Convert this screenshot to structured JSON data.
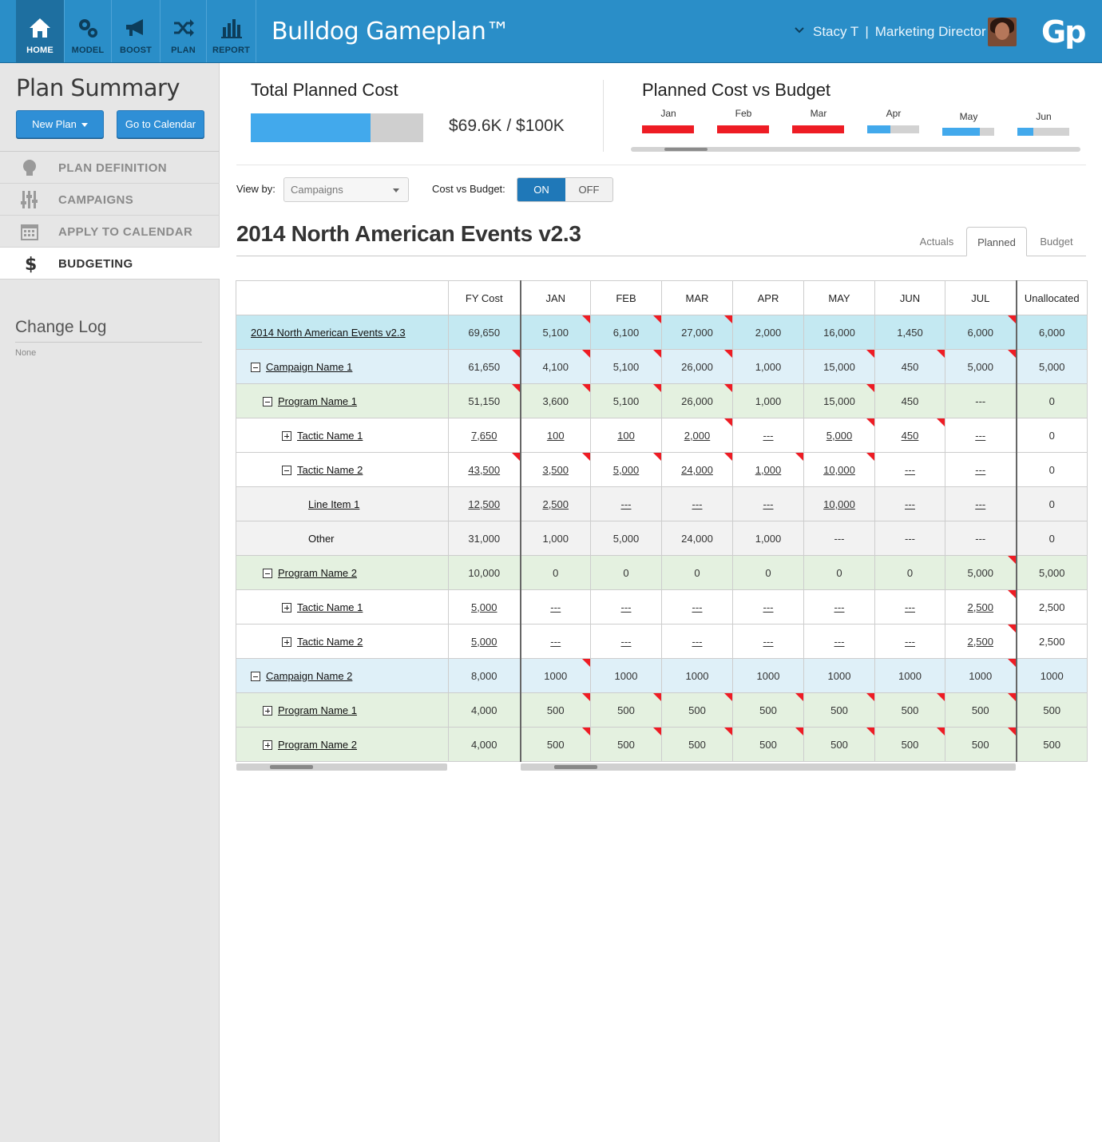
{
  "app": {
    "title": "Bulldog Gameplan™",
    "logo": "Gp",
    "user": "Stacy T",
    "role": "Marketing Director"
  },
  "nav": [
    {
      "label": "HOME",
      "icon": "home-icon",
      "active": true
    },
    {
      "label": "MODEL",
      "icon": "gears-icon",
      "active": false
    },
    {
      "label": "BOOST",
      "icon": "megaphone-icon",
      "active": false
    },
    {
      "label": "PLAN",
      "icon": "shuffle-icon",
      "active": false
    },
    {
      "label": "REPORT",
      "icon": "bar-chart-icon",
      "active": false
    }
  ],
  "sidebar": {
    "title": "Plan Summary",
    "new_plan_label": "New Plan",
    "calendar_label": "Go to Calendar",
    "items": [
      {
        "label": "PLAN DEFINITION",
        "icon": "lightbulb-icon",
        "active": false
      },
      {
        "label": "CAMPAIGNS",
        "icon": "sliders-icon",
        "active": false
      },
      {
        "label": "APPLY TO CALENDAR",
        "icon": "calendar-icon",
        "active": false
      },
      {
        "label": "BUDGETING",
        "icon": "dollar-icon",
        "active": true
      }
    ],
    "changelog_title": "Change Log",
    "changelog_value": "None"
  },
  "summary": {
    "total_title": "Total Planned Cost",
    "total_text": "$69.6K / $100K",
    "total_fraction": 0.696,
    "vs_title": "Planned Cost vs Budget",
    "months": [
      {
        "label": "Jan",
        "fraction": 1.0,
        "color": "#ee1c24"
      },
      {
        "label": "Feb",
        "fraction": 1.0,
        "color": "#ee1c24"
      },
      {
        "label": "Mar",
        "fraction": 1.0,
        "color": "#ee1c24"
      },
      {
        "label": "Apr",
        "fraction": 0.45,
        "color": "#42a9ec"
      },
      {
        "label": "May",
        "fraction": 0.72,
        "color": "#42a9ec"
      },
      {
        "label": "Jun",
        "fraction": 0.3,
        "color": "#42a9ec"
      }
    ]
  },
  "controls": {
    "view_by_label": "View by:",
    "view_by_value": "Campaigns",
    "cost_vs_budget_label": "Cost vs Budget:",
    "on_label": "ON",
    "off_label": "OFF"
  },
  "plan_title": "2014 North American Events v2.3",
  "tabs": [
    "Actuals",
    "Planned",
    "Budget"
  ],
  "active_tab": "Planned",
  "grid": {
    "headers": [
      "",
      "FY Cost",
      "JAN",
      "FEB",
      "MAR",
      "APR",
      "MAY",
      "JUN",
      "JUL",
      "Unallocated"
    ],
    "rows": [
      {
        "level": "plan",
        "name": "2014 North American Events v2.3",
        "expander": "",
        "cells": [
          "69,650",
          "5,100",
          "6,100",
          "27,000",
          "2,000",
          "16,000",
          "1,450",
          "6,000",
          "6,000"
        ]
      },
      {
        "level": "camp",
        "name": "Campaign Name 1",
        "expander": "minus",
        "cells": [
          "61,650",
          "4,100",
          "5,100",
          "26,000",
          "1,000",
          "15,000",
          "450",
          "5,000",
          "5,000"
        ]
      },
      {
        "level": "prog",
        "name": "Program Name 1",
        "expander": "minus",
        "cells": [
          "51,150",
          "3,600",
          "5,100",
          "26,000",
          "1,000",
          "15,000",
          "450",
          "---",
          "0"
        ]
      },
      {
        "level": "tact",
        "name": "Tactic Name 1",
        "expander": "plus",
        "cells": [
          "7,650",
          "100",
          "100",
          "2,000",
          "---",
          "5,000",
          "450",
          "---",
          "0"
        ]
      },
      {
        "level": "tact",
        "name": "Tactic Name 2",
        "expander": "minus",
        "cells": [
          "43,500",
          "3,500",
          "5,000",
          "24,000",
          "1,000",
          "10,000",
          "---",
          "---",
          "0"
        ]
      },
      {
        "level": "item",
        "name": "Line Item 1",
        "expander": "",
        "cells": [
          "12,500",
          "2,500",
          "---",
          "---",
          "---",
          "10,000",
          "---",
          "---",
          "0"
        ]
      },
      {
        "level": "item",
        "name": "Other",
        "expander": "",
        "cells": [
          "31,000",
          "1,000",
          "5,000",
          "24,000",
          "1,000",
          "---",
          "---",
          "---",
          "0"
        ]
      },
      {
        "level": "prog",
        "name": "Program Name 2",
        "expander": "minus",
        "cells": [
          "10,000",
          "0",
          "0",
          "0",
          "0",
          "0",
          "0",
          "5,000",
          "5,000"
        ]
      },
      {
        "level": "tact",
        "name": "Tactic Name 1",
        "expander": "plus",
        "cells": [
          "5,000",
          "---",
          "---",
          "---",
          "---",
          "---",
          "---",
          "2,500",
          "2,500"
        ]
      },
      {
        "level": "tact",
        "name": "Tactic Name 2",
        "expander": "plus",
        "cells": [
          "5,000",
          "---",
          "---",
          "---",
          "---",
          "---",
          "---",
          "2,500",
          "2,500"
        ]
      },
      {
        "level": "camp",
        "name": "Campaign Name 2",
        "expander": "minus",
        "cells": [
          "8,000",
          "1000",
          "1000",
          "1000",
          "1000",
          "1000",
          "1000",
          "1000",
          "1000"
        ]
      },
      {
        "level": "prog",
        "name": "Program Name 1",
        "expander": "plus",
        "cells": [
          "4,000",
          "500",
          "500",
          "500",
          "500",
          "500",
          "500",
          "500",
          "500"
        ]
      },
      {
        "level": "prog",
        "name": "Program Name 2",
        "expander": "plus",
        "cells": [
          "4,000",
          "500",
          "500",
          "500",
          "500",
          "500",
          "500",
          "500",
          "500"
        ]
      }
    ]
  }
}
